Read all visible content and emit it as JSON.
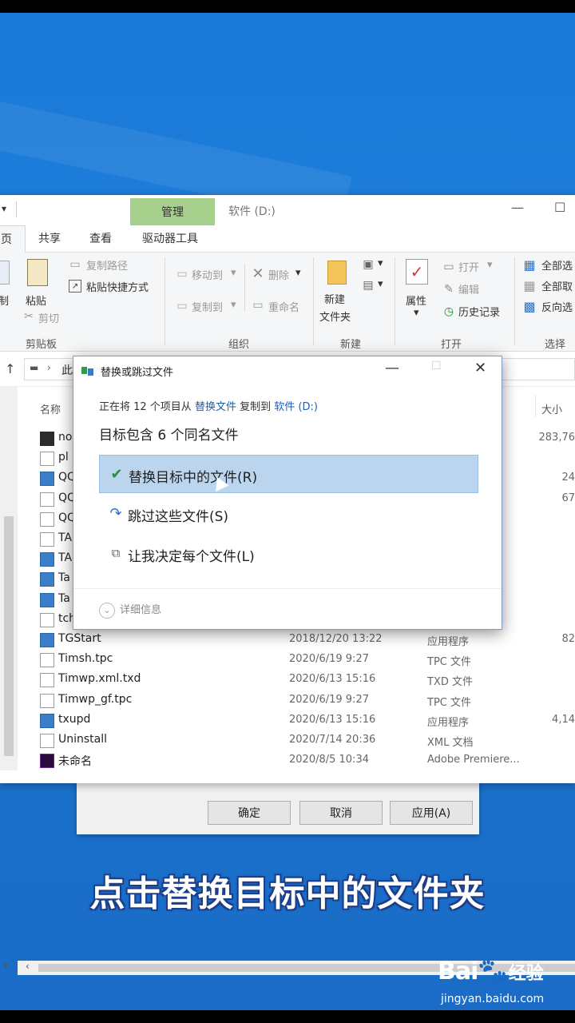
{
  "explorer": {
    "title": "软件 (D:)",
    "manage_tab": "管理",
    "tabs": [
      "页",
      "共享",
      "查看",
      "驱动器工具"
    ],
    "ribbon": {
      "clipboard": {
        "paste": "粘贴",
        "copy_path": "复制路径",
        "paste_shortcut": "粘贴快捷方式",
        "cut": "剪切",
        "copy": "制",
        "label": "剪贴板"
      },
      "organize": {
        "move_to": "移动到",
        "copy_to": "复制到",
        "delete": "删除",
        "rename": "重命名",
        "label": "组织"
      },
      "new": {
        "new_folder_line1": "新建",
        "new_folder_line2": "文件夹",
        "label": "新建"
      },
      "open": {
        "properties": "属性",
        "open": "打开",
        "edit": "编辑",
        "history": "历史记录",
        "label": "打开"
      },
      "select": {
        "select_all": "全部选",
        "select_none": "全部取",
        "invert": "反向选",
        "label": "选择"
      }
    },
    "address": {
      "path_partial": "此"
    },
    "columns": {
      "name": "名称",
      "size": "大小"
    },
    "files": [
      {
        "name": "no",
        "date": "",
        "type": "",
        "size": "283,76"
      },
      {
        "name": "pl",
        "date": "",
        "type": "",
        "size": ""
      },
      {
        "name": "QQ",
        "date": "",
        "type": "",
        "size": "24"
      },
      {
        "name": "QQ",
        "date": "",
        "type": "",
        "size": "67"
      },
      {
        "name": "QQ",
        "date": "",
        "type": "",
        "size": ""
      },
      {
        "name": "TA",
        "date": "",
        "type": "",
        "size": ""
      },
      {
        "name": "TA",
        "date": "",
        "type": "",
        "size": ""
      },
      {
        "name": "Ta",
        "date": "",
        "type": "",
        "size": ""
      },
      {
        "name": "Ta",
        "date": "",
        "type": "",
        "size": ""
      },
      {
        "name": "tch",
        "date": "",
        "type": "",
        "size": ""
      },
      {
        "name": "TGStart",
        "date": "2018/12/20 13:22",
        "type": "应用程序",
        "size": "82"
      },
      {
        "name": "Timsh.tpc",
        "date": "2020/6/19 9:27",
        "type": "TPC 文件",
        "size": ""
      },
      {
        "name": "Timwp.xml.txd",
        "date": "2020/6/13 15:16",
        "type": "TXD 文件",
        "size": ""
      },
      {
        "name": "Timwp_gf.tpc",
        "date": "2020/6/19 9:27",
        "type": "TPC 文件",
        "size": ""
      },
      {
        "name": "txupd",
        "date": "2020/6/13 15:16",
        "type": "应用程序",
        "size": "4,14"
      },
      {
        "name": "Uninstall",
        "date": "2020/7/14 20:36",
        "type": "XML 文档",
        "size": ""
      },
      {
        "name": "未命名",
        "date": "2020/8/5 10:34",
        "type": "Adobe Premiere...",
        "size": ""
      }
    ]
  },
  "dialog": {
    "title": "替换或跳过文件",
    "line1_prefix": "正在将 12 个项目从",
    "line1_source": "替换文件",
    "line1_mid": "复制到",
    "line1_dest": "软件 (D:)",
    "line2": "目标包含 6 个同名文件",
    "options": [
      {
        "label": "替换目标中的文件(R)",
        "icon": "checkmark-icon"
      },
      {
        "label": "跳过这些文件(S)",
        "icon": "skip-icon"
      },
      {
        "label": "让我决定每个文件(L)",
        "icon": "decide-icon"
      }
    ],
    "details": "详细信息"
  },
  "background_dialog": {
    "ok": "确定",
    "cancel": "取消",
    "apply": "应用(A)"
  },
  "caption": "点击替换目标中的文件夹",
  "watermark": {
    "brand": "Bai",
    "brand_suffix": "经验",
    "url": "jingyan.baidu.com"
  }
}
